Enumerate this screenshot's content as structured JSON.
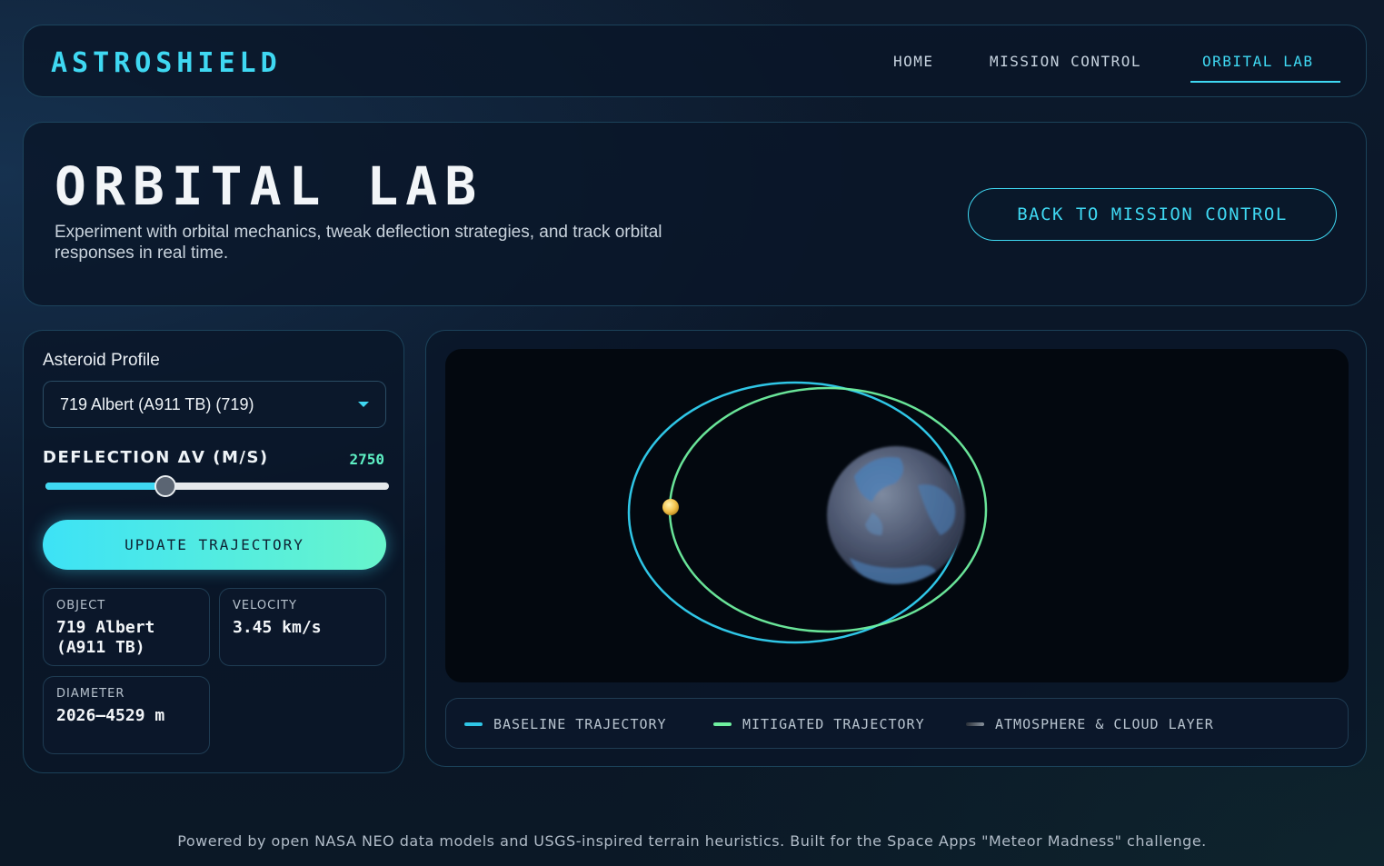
{
  "nav": {
    "brand": "ASTROSHIELD",
    "links": [
      "HOME",
      "MISSION CONTROL",
      "ORBITAL LAB"
    ],
    "active": "ORBITAL LAB"
  },
  "hero": {
    "title": "ORBITAL LAB",
    "description": "Experiment with orbital mechanics, tweak deflection strategies, and track orbital responses in real time.",
    "back_button": "BACK TO MISSION CONTROL"
  },
  "controls": {
    "profile_label": "Asteroid Profile",
    "selected_asteroid": "719 Albert (A911 TB) (719)",
    "deflection_label": "DEFLECTION ΔV (M/S)",
    "deflection_value": "2750",
    "deflection_fraction": 0.35,
    "update_button": "UPDATE TRAJECTORY"
  },
  "stats": {
    "object_label": "OBJECT",
    "object_value": "719 Albert (A911 TB)",
    "velocity_label": "VELOCITY",
    "velocity_value": "3.45 km/s",
    "diameter_label": "DIAMETER",
    "diameter_value": "2026–4529 m"
  },
  "legend": {
    "baseline": "BASELINE TRAJECTORY",
    "mitigated": "MITIGATED TRAJECTORY",
    "atmosphere": "ATMOSPHERE & CLOUD LAYER"
  },
  "colors": {
    "accent": "#3fd8f2",
    "baseline": "#2fc6e6",
    "mitigated": "#6ff0a0",
    "atmosphere": "#6b7480",
    "asteroid": "#f2c14a"
  },
  "footer": "Powered by open NASA NEO data models and USGS-inspired terrain heuristics. Built for the Space Apps \"Meteor Madness\" challenge."
}
